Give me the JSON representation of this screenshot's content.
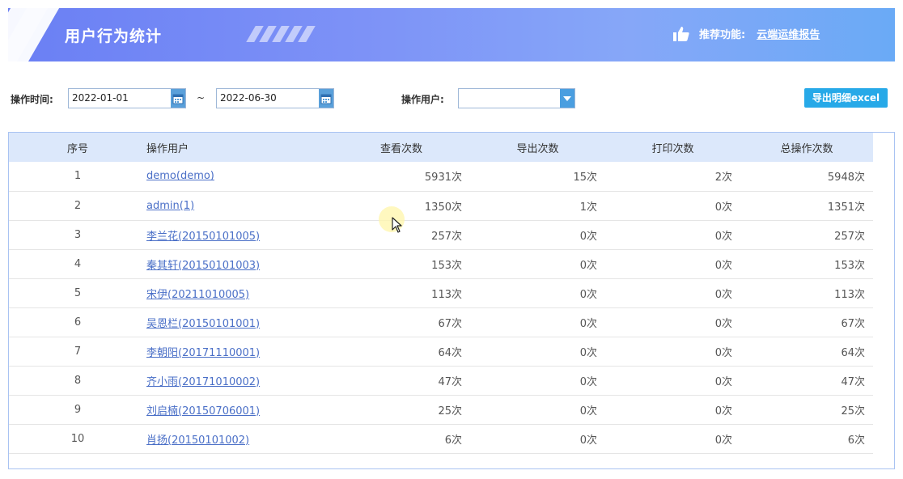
{
  "header": {
    "title": "用户行为统计",
    "recommend_label": "推荐功能:",
    "recommend_link": "云端运维报告"
  },
  "filters": {
    "time_label": "操作时间:",
    "start_date": "2022-01-01",
    "separator": "~",
    "end_date": "2022-06-30",
    "user_label": "操作用户:",
    "user_value": "",
    "export_label": "导出明细excel"
  },
  "table": {
    "columns": [
      "序号",
      "操作用户",
      "查看次数",
      "导出次数",
      "打印次数",
      "总操作次数"
    ],
    "rows": [
      {
        "idx": "1",
        "user": "demo(demo)",
        "view": "5931次",
        "export": "15次",
        "print": "2次",
        "total": "5948次"
      },
      {
        "idx": "2",
        "user": "admin(1)",
        "view": "1350次",
        "export": "1次",
        "print": "0次",
        "total": "1351次"
      },
      {
        "idx": "3",
        "user": "李兰花(20150101005)",
        "view": "257次",
        "export": "0次",
        "print": "0次",
        "total": "257次"
      },
      {
        "idx": "4",
        "user": "秦其轩(20150101003)",
        "view": "153次",
        "export": "0次",
        "print": "0次",
        "total": "153次"
      },
      {
        "idx": "5",
        "user": "宋伊(20211010005)",
        "view": "113次",
        "export": "0次",
        "print": "0次",
        "total": "113次"
      },
      {
        "idx": "6",
        "user": "吴恩栏(20150101001)",
        "view": "67次",
        "export": "0次",
        "print": "0次",
        "total": "67次"
      },
      {
        "idx": "7",
        "user": "李朝阳(20171110001)",
        "view": "64次",
        "export": "0次",
        "print": "0次",
        "total": "64次"
      },
      {
        "idx": "8",
        "user": "齐小雨(20171010002)",
        "view": "47次",
        "export": "0次",
        "print": "0次",
        "total": "47次"
      },
      {
        "idx": "9",
        "user": "刘启楠(20150706001)",
        "view": "25次",
        "export": "0次",
        "print": "0次",
        "total": "25次"
      },
      {
        "idx": "10",
        "user": "肖扬(20150101002)",
        "view": "6次",
        "export": "0次",
        "print": "0次",
        "total": "6次"
      }
    ]
  },
  "icons": {
    "recommend": "thumbs-up-icon",
    "date_picker": "calendar-icon",
    "select": "chevron-down-icon"
  },
  "colors": {
    "banner_start": "#6a7ff4",
    "banner_end": "#6aaaf6",
    "export_button": "#27a9e8",
    "link": "#4a6fc7",
    "table_header": "#dce8fb"
  }
}
